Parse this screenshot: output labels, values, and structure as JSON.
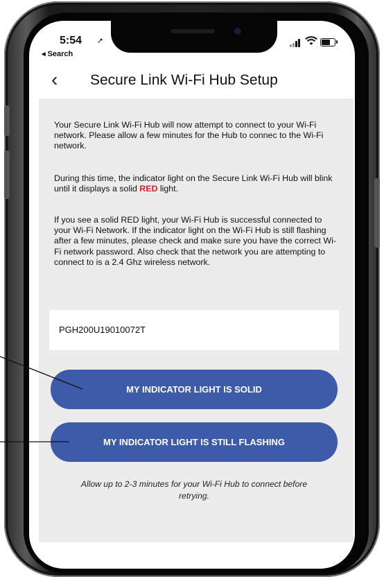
{
  "status_bar": {
    "time": "5:54",
    "back_app": "◂ Search"
  },
  "header": {
    "title": "Secure Link Wi-Fi Hub Setup"
  },
  "instructions": {
    "p1": "Your Secure Link Wi-Fi Hub will now attempt to connect to your Wi-Fi network.  Please allow a few minutes for the Hub to connec to the Wi-Fi network.",
    "p2_before": "During this time, the indicator light on the Secure Link Wi-Fi Hub will blink until it displays a solid ",
    "p2_red": "RED",
    "p2_after": " light.",
    "p3": "If you see a solid RED light, your Wi-Fi Hub is successful connected to your Wi-Fi Network.  If the indicator light on the Wi-Fi Hub is still flashing after a few minutes, please check and make sure you have the correct Wi-Fi network password.  Also check that the network you are attempting to connect to is a 2.4 Ghz wireless network."
  },
  "device": {
    "serial": "PGH200U19010072T"
  },
  "buttons": {
    "solid": "MY INDICATOR LIGHT IS SOLID",
    "flashing": "MY INDICATOR LIGHT IS STILL FLASHING"
  },
  "footer_note": "Allow up to 2-3 minutes for your Wi-Fi Hub to connect before retrying.",
  "colors": {
    "accent_button": "#3d5ba8",
    "alert_red": "#e41d24",
    "panel_bg": "#ececec"
  },
  "icons": [
    "location-arrow-icon",
    "signal-icon",
    "wifi-icon",
    "battery-icon",
    "back-chevron-icon"
  ]
}
